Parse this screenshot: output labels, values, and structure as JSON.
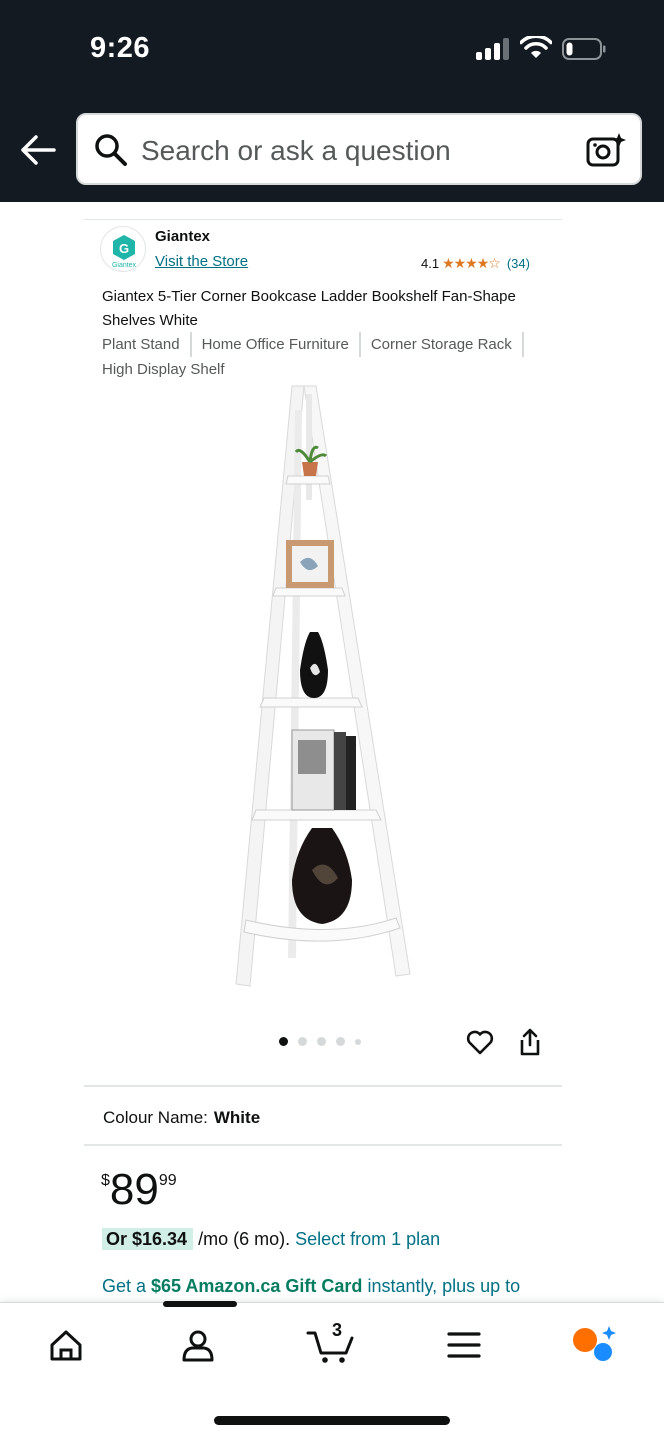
{
  "status": {
    "time": "9:26"
  },
  "search": {
    "placeholder": "Search or ask a question"
  },
  "store": {
    "brand": "Giantex",
    "logo_text": "Giantex",
    "visit_link": "Visit the Store",
    "rating_value": "4.1",
    "stars": "★★★★☆",
    "review_count": "(34)"
  },
  "product": {
    "title": "Giantex 5-Tier Corner Bookcase Ladder Bookshelf Fan-Shape Shelves White",
    "tags": [
      "Plant Stand",
      "Home Office Furniture",
      "Corner Storage Rack",
      "High Display Shelf"
    ],
    "image_count": 5,
    "active_image": 1
  },
  "variation": {
    "label": "Colour Name:",
    "value": "White"
  },
  "price": {
    "symbol": "$",
    "whole": "89",
    "fraction": "99"
  },
  "financing": {
    "prefix": "Or ",
    "amount": "$16.34",
    "suffix": " /mo (6 mo). ",
    "link": "Select from 1 plan"
  },
  "gift": {
    "prefix": "Get a ",
    "highlight": "$65 Amazon.ca Gift Card",
    "suffix": " instantly, plus up to"
  },
  "nav": {
    "cart_count": "3",
    "items": [
      "home-icon",
      "account-icon",
      "cart-icon",
      "menu-icon",
      "rufus-icon"
    ]
  },
  "colors": {
    "header_bg": "#131a22",
    "link": "#007185",
    "star": "#de7921",
    "gift_green": "#067d62",
    "financing_highlight": "#d2efe7",
    "logo_teal": "#1fb5a8",
    "rufus_orange": "#ff6f00",
    "rufus_blue": "#1a8cff"
  }
}
